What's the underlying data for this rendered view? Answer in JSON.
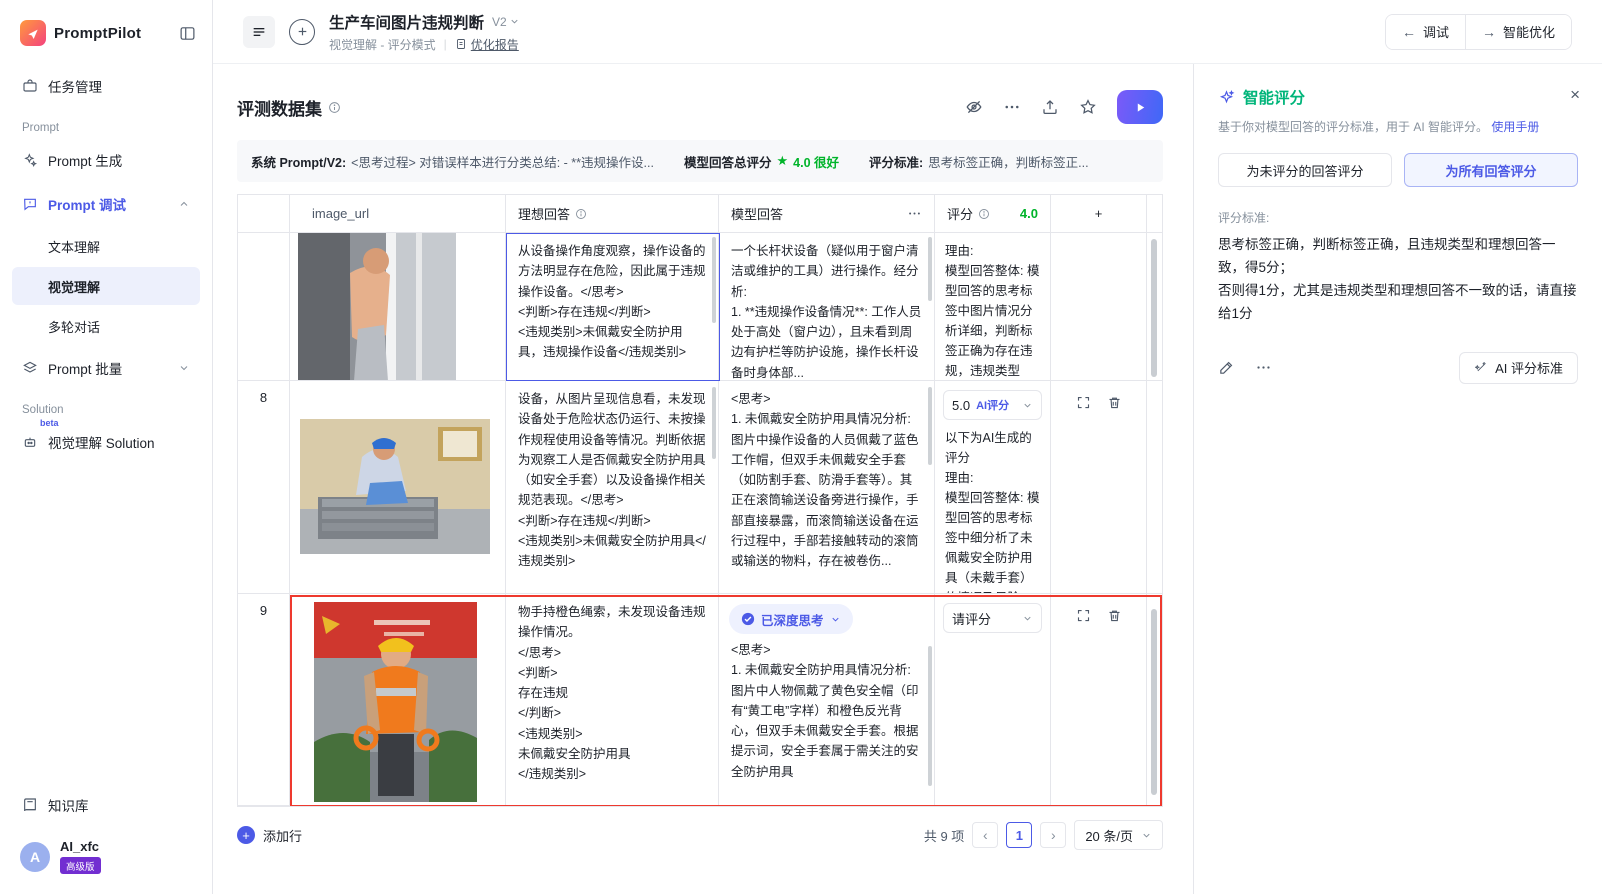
{
  "brand": {
    "name": "PromptPilot"
  },
  "sidebar": {
    "task_mgmt": "任务管理",
    "prompt_section": "Prompt",
    "prompt_gen": "Prompt 生成",
    "prompt_debug": "Prompt 调试",
    "sub_text": "文本理解",
    "sub_vision": "视觉理解",
    "sub_multi": "多轮对话",
    "prompt_batch": "Prompt 批量",
    "solution_section": "Solution",
    "solution_vision": "视觉理解 Solution",
    "solution_beta": "beta",
    "knowledge": "知识库",
    "user_initial": "A",
    "user_name": "AI_xfc",
    "user_badge": "高级版"
  },
  "topbar": {
    "title": "生产车间图片违规判断",
    "version": "V2",
    "mode": "视觉理解 - 评分模式",
    "report": "优化报告",
    "debug": "调试",
    "optimize": "智能优化"
  },
  "dataset": {
    "title": "评测数据集",
    "info": {
      "system_label": "系统 Prompt/V2:",
      "system_text": "<思考过程> 对错误样本进行分类总结: - **违规操作设...",
      "score_label": "模型回答总评分",
      "score_star": "★",
      "score_value": "4.0 很好",
      "criteria_label": "评分标准:",
      "criteria_text": "思考标签正确，判断标签正..."
    },
    "columns": {
      "image": "image_url",
      "ideal": "理想回答",
      "model": "模型回答",
      "score": "评分",
      "score_value": "4.0",
      "add": "+"
    },
    "rows": [
      {
        "index": "",
        "ideal": "从设备操作角度观察，操作设备的方法明显存在危险，因此属于违规操作设备。</思考>\n<判断>存在违规</判断>\n<违规类别>未佩戴安全防护用具，违规操作设备</违规类别>",
        "model": "一个长杆状设备（疑似用于窗户清洁或维护的工具）进行操作。经分析:\n1. **违规操作设备情况**: 工作人员处于高处（窗户边），且未看到周边有护栏等防护设施，操作长杆设备时身体部...",
        "score_text": "理由:\n模型回答整体: 模型回答的思考标签中图片情况分析详细，判断标签正确为存在违规，违规类型与..."
      },
      {
        "index": "8",
        "ideal": "设备，从图片呈现信息看，未发现设备处于危险状态仍运行、未按操作规程使用设备等情况。判断依据为观察工人是否佩戴安全防护用具（如安全手套）以及设备操作相关规范表现。</思考>\n<判断>存在违规</判断>\n<违规类别>未佩戴安全防护用具</违规类别>",
        "model": "<思考>\n1. 未佩戴安全防护用具情况分析: 图片中操作设备的人员佩戴了蓝色工作帽，但双手未佩戴安全手套（如防割手套、防滑手套等）。其正在滚筒输送设备旁进行操作，手部直接暴露，而滚筒输送设备在运行过程中，手部若接触转动的滚筒或输送的物料，存在被卷伤...",
        "score_select": "5.0",
        "score_tag": "AI评分",
        "score_text": "以下为AI生成的评分\n理由:\n模型回答整体: 模型回答的思考标签中细分析了未佩戴安全防护用具（未戴手套）的情况及风险"
      },
      {
        "index": "9",
        "ideal": "物手持橙色绳索，未发现设备违规操作情况。\n</思考>\n<判断>\n存在违规\n</判断>\n<违规类别>\n未佩戴安全防护用具\n</违规类别>",
        "deep_pill": "已深度思考",
        "model": "<思考>\n1. 未佩戴安全防护用具情况分析: 图片中人物佩戴了黄色安全帽（印有“黄工电”字样）和橙色反光背心，但双手未佩戴安全手套。根据提示词，安全手套属于需关注的安全防护用具",
        "score_select": "请评分"
      }
    ],
    "add_row": "添加行",
    "total": "共 9 项",
    "prev": "‹",
    "page": "1",
    "next": "›",
    "page_size": "20 条/页"
  },
  "panel": {
    "title": "智能评分",
    "desc": "基于你对模型回答的评分标准，用于 AI 智能评分。",
    "manual": "使用手册",
    "close": "×",
    "btn_unscored": "为未评分的回答评分",
    "btn_all": "为所有回答评分",
    "criteria_label": "评分标准:",
    "criteria": "思考标签正确，判断标签正确，且违规类型和理想回答一致，得5分；\n否则得1分，尤其是违规类型和理想回答不一致的话，请直接给1分",
    "ai_btn": "AI 评分标准"
  }
}
